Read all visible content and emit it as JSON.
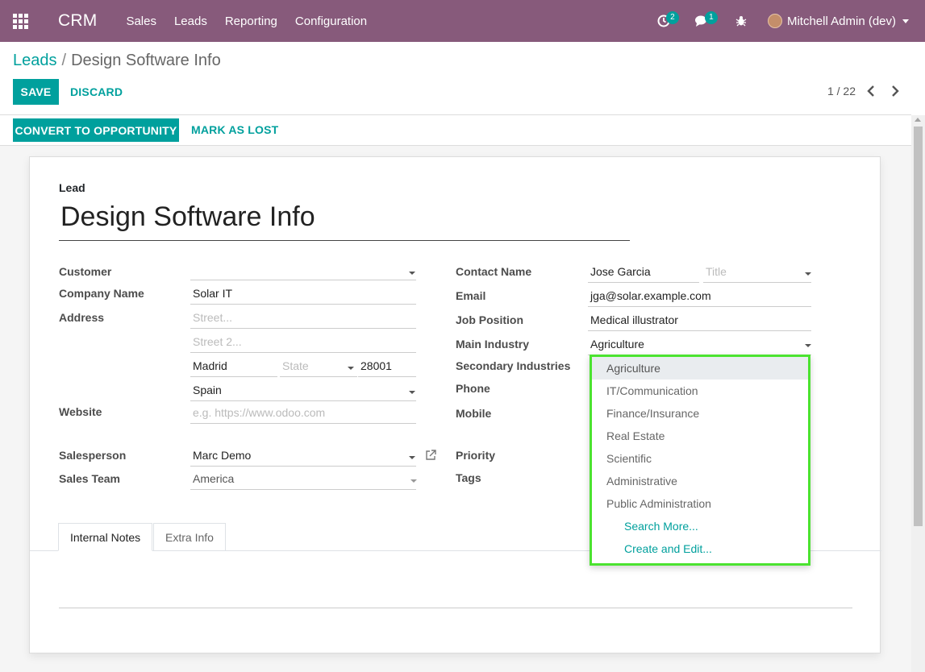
{
  "navbar": {
    "brand": "CRM",
    "menus": [
      "Sales",
      "Leads",
      "Reporting",
      "Configuration"
    ],
    "activity_count": "2",
    "message_count": "1",
    "user": "Mitchell Admin (dev)"
  },
  "breadcrumb": {
    "parent": "Leads",
    "sep": "/",
    "current": "Design Software Info"
  },
  "buttons": {
    "save": "SAVE",
    "discard": "DISCARD",
    "convert": "CONVERT TO OPPORTUNITY",
    "mark_lost": "MARK AS LOST"
  },
  "pager": "1 / 22",
  "form": {
    "type_label": "Lead",
    "title": "Design Software Info",
    "labels": {
      "customer": "Customer",
      "company": "Company Name",
      "address": "Address",
      "website": "Website",
      "salesperson": "Salesperson",
      "sales_team": "Sales Team",
      "contact": "Contact Name",
      "email": "Email",
      "job": "Job Position",
      "industry": "Main Industry",
      "secondary": "Secondary Industries",
      "phone": "Phone",
      "mobile": "Mobile",
      "priority": "Priority",
      "tags": "Tags"
    },
    "values": {
      "customer": "",
      "company": "Solar IT",
      "city": "Madrid",
      "zip": "28001",
      "country": "Spain",
      "salesperson": "Marc Demo",
      "contact": "Jose Garcia",
      "email": "jga@solar.example.com",
      "job": "Medical illustrator",
      "industry": "Agriculture"
    },
    "placeholders": {
      "street": "Street...",
      "street2": "Street 2...",
      "state": "State",
      "website": "e.g. https://www.odoo.com",
      "sales_team": "America",
      "title": "Title"
    }
  },
  "tabs": [
    "Internal Notes",
    "Extra Info"
  ],
  "dropdown": {
    "options": [
      "Agriculture",
      "IT/Communication",
      "Finance/Insurance",
      "Real Estate",
      "Scientific",
      "Administrative",
      "Public Administration"
    ],
    "actions": [
      "Search More...",
      "Create and Edit..."
    ]
  },
  "colors": {
    "brand": "#875a7b",
    "accent": "#00a09d",
    "highlight_border": "#4be330"
  }
}
